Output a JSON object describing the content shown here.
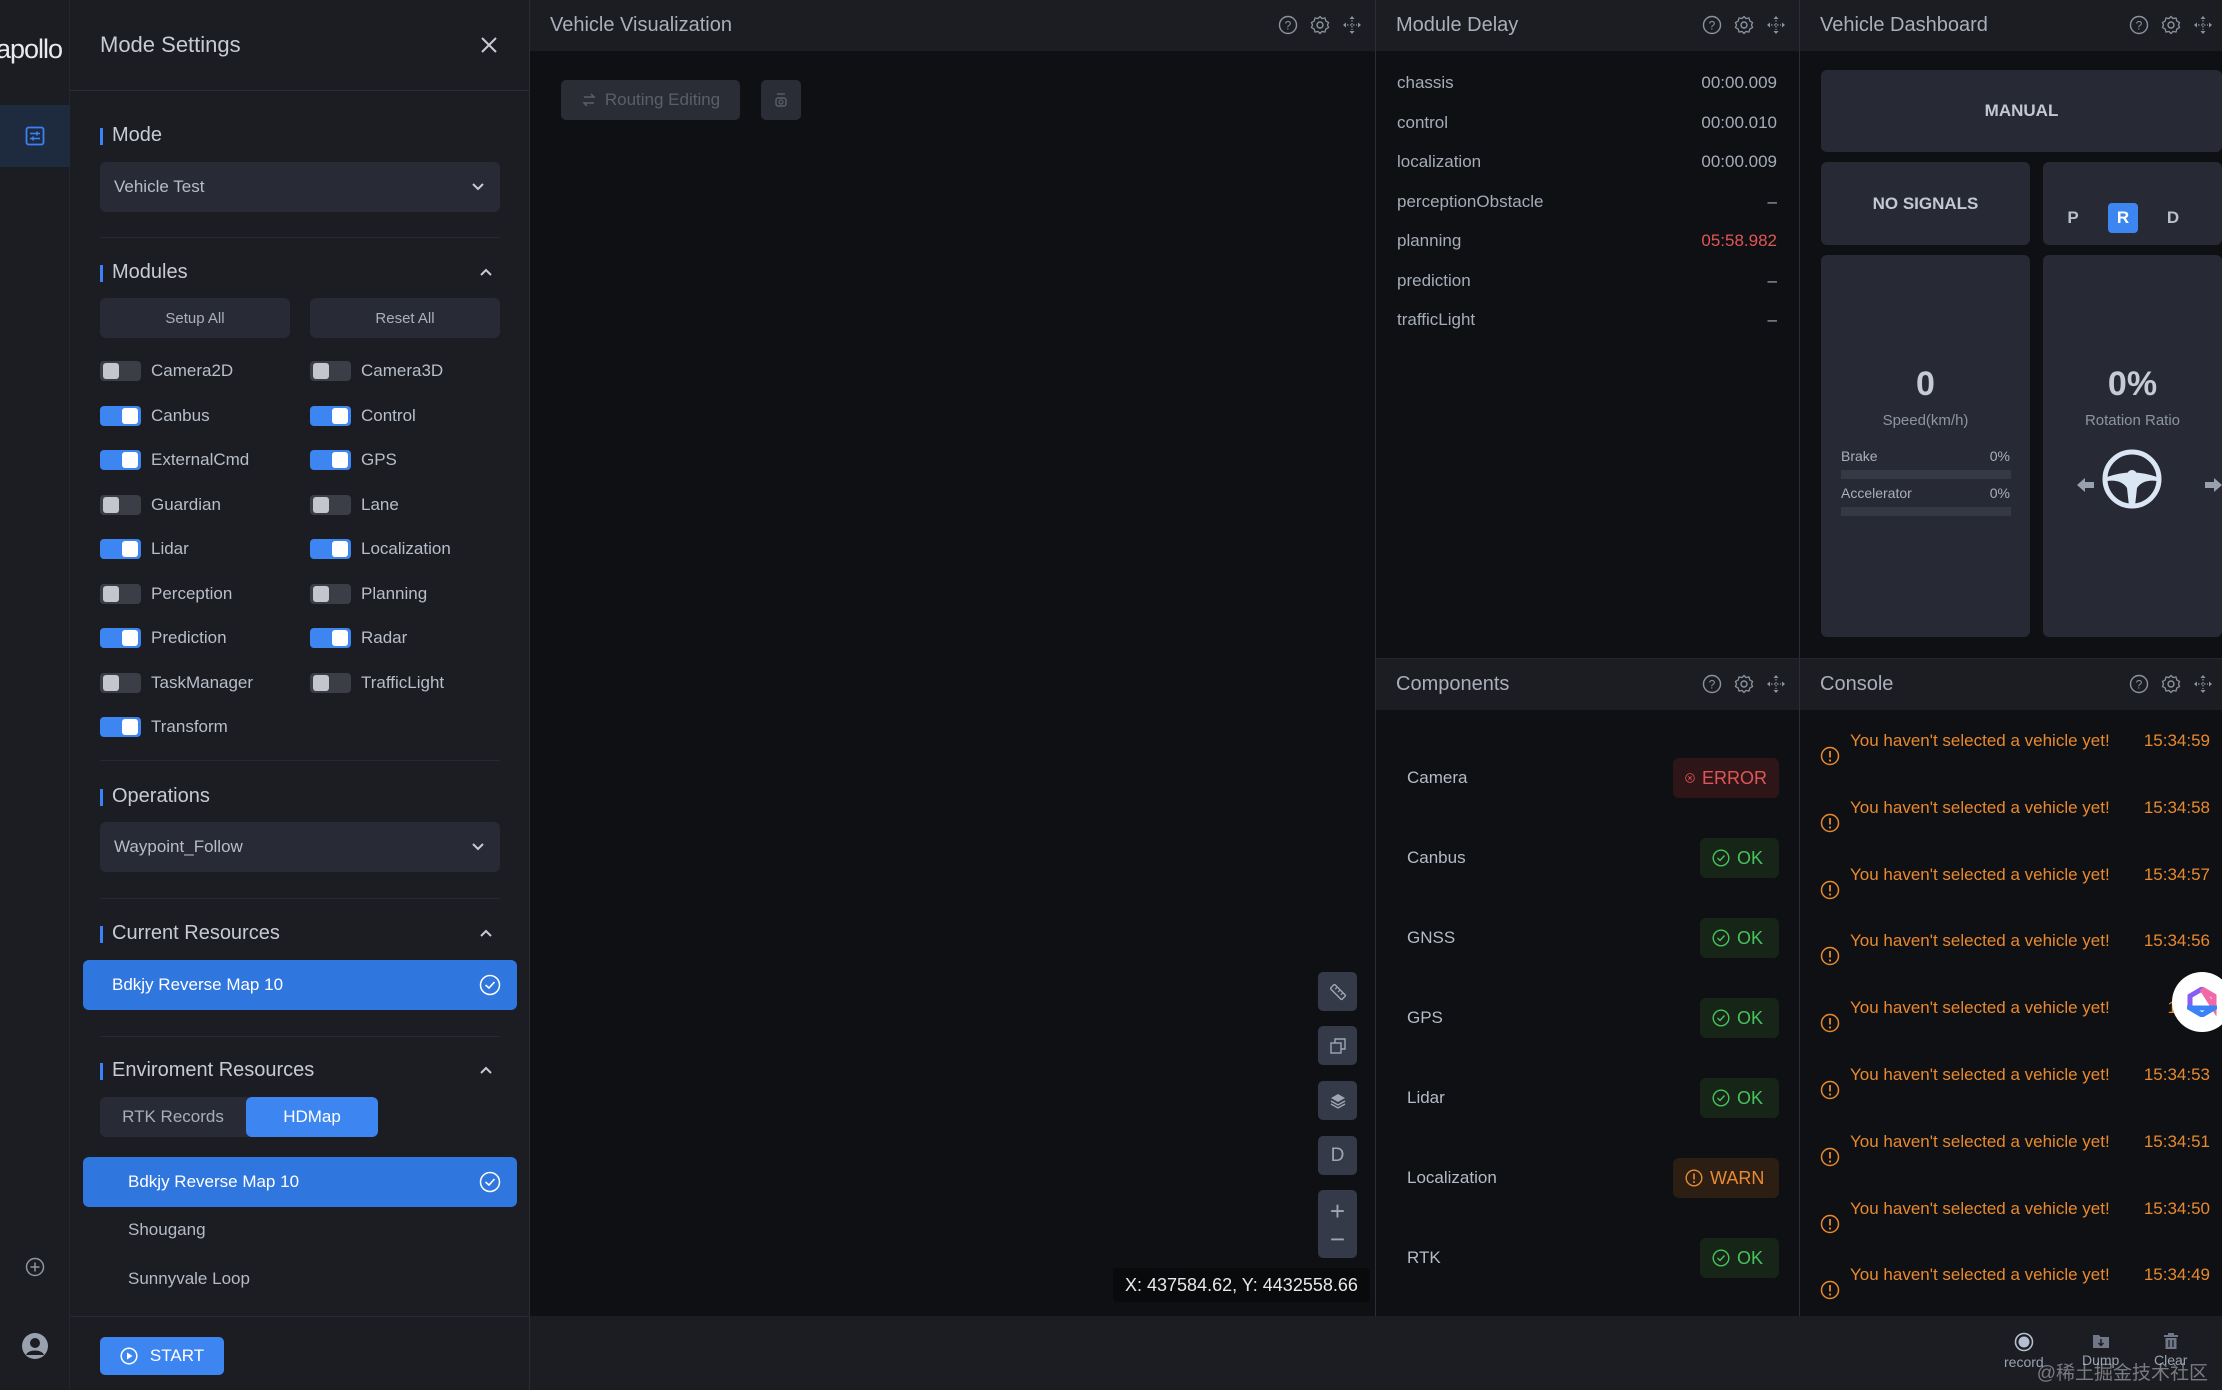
{
  "app": {
    "logo": "apollo"
  },
  "mode_settings": {
    "title": "Mode Settings",
    "mode": {
      "title": "Mode",
      "selected": "Vehicle Test"
    },
    "modules": {
      "title": "Modules",
      "setup_all": "Setup All",
      "reset_all": "Reset All",
      "items": [
        {
          "label": "Camera2D",
          "on": false
        },
        {
          "label": "Camera3D",
          "on": false
        },
        {
          "label": "Canbus",
          "on": true
        },
        {
          "label": "Control",
          "on": true
        },
        {
          "label": "ExternalCmd",
          "on": true
        },
        {
          "label": "GPS",
          "on": true
        },
        {
          "label": "Guardian",
          "on": false
        },
        {
          "label": "Lane",
          "on": false
        },
        {
          "label": "Lidar",
          "on": true
        },
        {
          "label": "Localization",
          "on": true
        },
        {
          "label": "Perception",
          "on": false
        },
        {
          "label": "Planning",
          "on": false
        },
        {
          "label": "Prediction",
          "on": true
        },
        {
          "label": "Radar",
          "on": true
        },
        {
          "label": "TaskManager",
          "on": false
        },
        {
          "label": "TrafficLight",
          "on": false
        },
        {
          "label": "Transform",
          "on": true
        }
      ]
    },
    "operations": {
      "title": "Operations",
      "selected": "Waypoint_Follow"
    },
    "current_resources": {
      "title": "Current Resources",
      "selected": "Bdkjy Reverse Map 10"
    },
    "environment_resources": {
      "title": "Enviroment Resources",
      "tabs": [
        {
          "label": "RTK Records",
          "active": false
        },
        {
          "label": "HDMap",
          "active": true
        }
      ],
      "items": [
        {
          "label": "Bdkjy Reverse Map 10",
          "selected": true
        },
        {
          "label": "Shougang",
          "selected": false
        },
        {
          "label": "Sunnyvale Loop",
          "selected": false
        }
      ]
    },
    "start_label": "START"
  },
  "visualization": {
    "title": "Vehicle Visualization",
    "routing_editing_label": "Routing Editing",
    "tools": {
      "distance": "ruler-icon",
      "copy": "copy-icon",
      "layers": "layers-icon",
      "dimension": "D",
      "zoom_in": "+",
      "zoom_out": "−"
    },
    "coordinates": "X: 437584.62, Y: 4432558.66"
  },
  "module_delay": {
    "title": "Module Delay",
    "rows": [
      {
        "name": "chassis",
        "value": "00:00.009",
        "alert": false
      },
      {
        "name": "control",
        "value": "00:00.010",
        "alert": false
      },
      {
        "name": "localization",
        "value": "00:00.009",
        "alert": false
      },
      {
        "name": "perceptionObstacle",
        "value": "–",
        "alert": false
      },
      {
        "name": "planning",
        "value": "05:58.982",
        "alert": true
      },
      {
        "name": "prediction",
        "value": "–",
        "alert": false
      },
      {
        "name": "trafficLight",
        "value": "–",
        "alert": false
      }
    ]
  },
  "components": {
    "title": "Components",
    "rows": [
      {
        "name": "Camera",
        "status": "ERROR",
        "level": "err"
      },
      {
        "name": "Canbus",
        "status": "OK",
        "level": "ok"
      },
      {
        "name": "GNSS",
        "status": "OK",
        "level": "ok"
      },
      {
        "name": "GPS",
        "status": "OK",
        "level": "ok"
      },
      {
        "name": "Lidar",
        "status": "OK",
        "level": "ok"
      },
      {
        "name": "Localization",
        "status": "WARN",
        "level": "warn"
      },
      {
        "name": "RTK",
        "status": "OK",
        "level": "ok"
      }
    ]
  },
  "dashboard": {
    "title": "Vehicle Dashboard",
    "driving_mode": "MANUAL",
    "signal": "NO SIGNALS",
    "gears": [
      {
        "label": "P",
        "active": false
      },
      {
        "label": "R",
        "active": true
      },
      {
        "label": "D",
        "active": false
      }
    ],
    "speed": {
      "value": "0",
      "label": "Speed(km/h)"
    },
    "brake": {
      "label": "Brake",
      "value": "0%",
      "fraction": 0
    },
    "accelerator": {
      "label": "Accelerator",
      "value": "0%",
      "fraction": 0
    },
    "rotation": {
      "value": "0%",
      "label": "Rotation Ratio"
    }
  },
  "console": {
    "title": "Console",
    "logs": [
      {
        "message": "You haven't selected a vehicle yet!",
        "time": "15:34:59"
      },
      {
        "message": "You haven't selected a vehicle yet!",
        "time": "15:34:58"
      },
      {
        "message": "You haven't selected a vehicle yet!",
        "time": "15:34:57"
      },
      {
        "message": "You haven't selected a vehicle yet!",
        "time": "15:34:56"
      },
      {
        "message": "You haven't selected a vehicle yet!",
        "time": "15:34"
      },
      {
        "message": "You haven't selected a vehicle yet!",
        "time": "15:34:53"
      },
      {
        "message": "You haven't selected a vehicle yet!",
        "time": "15:34:51"
      },
      {
        "message": "You haven't selected a vehicle yet!",
        "time": "15:34:50"
      },
      {
        "message": "You haven't selected a vehicle yet!",
        "time": "15:34:49"
      }
    ]
  },
  "bottom_bar": {
    "record_label": "record",
    "dump_label": "Dump",
    "clear_label": "Clear",
    "watermark": "@稀土掘金技术社区"
  },
  "colors": {
    "accent": "#3d86f2",
    "ok": "#48c35a",
    "error": "#e05656",
    "warn": "#e88a33"
  }
}
